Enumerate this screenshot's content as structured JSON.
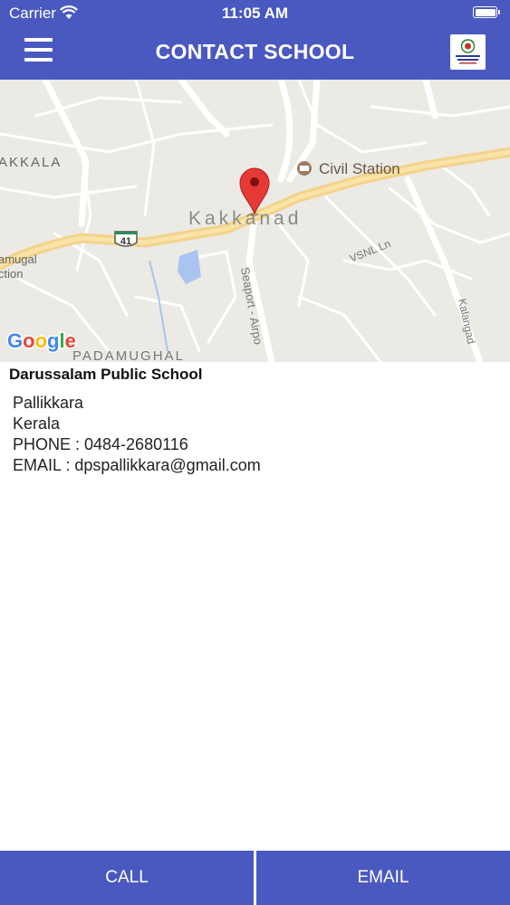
{
  "status_bar": {
    "carrier": "Carrier",
    "time": "11:05 AM",
    "icons": [
      "wifi-icon",
      "battery-icon"
    ]
  },
  "header": {
    "title": "CONTACT SCHOOL",
    "menu_icon": "hamburger-menu-icon",
    "background": "#4a59c0"
  },
  "map": {
    "labels": {
      "kakkala": "AKKALA",
      "civil_station": "Civil Station",
      "kakkanad": "Kakkanad",
      "highway": "41",
      "padamughal_left_1": "amugal",
      "padamughal_left_2": "ction",
      "padamughal": "PADAMUGHAL",
      "seaport": "Seaport - Airpo",
      "vsnl": "VSNL Ln",
      "kalangad": "Kalangad"
    },
    "google_letters": [
      "G",
      "o",
      "o",
      "g",
      "l",
      "e"
    ],
    "google_colors": [
      "#4285F4",
      "#EA4335",
      "#FBBC05",
      "#4285F4",
      "#34A853",
      "#EA4335"
    ]
  },
  "school": {
    "name": "Darussalam Public School",
    "address_line_1": "Pallikkara",
    "address_line_2": "Kerala",
    "phone": "PHONE : 0484-2680116",
    "email": "EMAIL : dpspallikkara@gmail.com"
  },
  "actions": {
    "call_label": "CALL",
    "email_label": "EMAIL"
  }
}
